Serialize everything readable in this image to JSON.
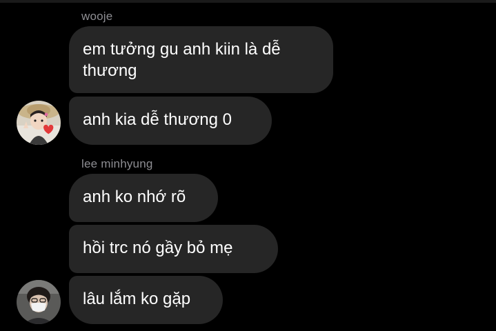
{
  "conversation": {
    "groups": [
      {
        "sender": "wooje",
        "avatar_icon": "user-avatar-icon",
        "messages": [
          {
            "text_line1": "em tưởng gu anh kiin là dễ",
            "text_line2": "thương"
          },
          {
            "text": "anh kia dễ thương 0"
          }
        ]
      },
      {
        "sender": "lee minhyung",
        "avatar_icon": "user-avatar-icon",
        "messages": [
          {
            "text": "anh ko nhớ rõ"
          },
          {
            "text": "hồi trc nó gầy bỏ mẹ"
          },
          {
            "text": "lâu lắm ko gặp"
          }
        ]
      }
    ]
  },
  "colors": {
    "background": "#000000",
    "bubble": "#262626",
    "sender_name": "#8e8e93",
    "text": "#ffffff"
  }
}
